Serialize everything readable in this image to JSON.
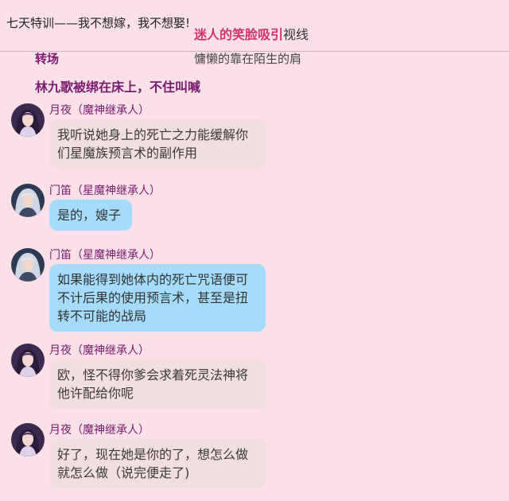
{
  "header": {
    "title": "七天特训——我不想嫁，我不想娶!",
    "overlay_highlight": "迷人的笑脸吸引",
    "overlay_rest": "视线"
  },
  "scene": {
    "label": "转场",
    "overlay": "慵懒的靠在陌生的肩"
  },
  "narration": "林九歌被绑在床上，不住叫喊",
  "messages": [
    {
      "speaker": "月夜（魔神继承人）",
      "text": "我听说她身上的死亡之力能缓解你们星魔族预言术的副作用",
      "avatar": "female-avatar-icon",
      "bubble": "pink"
    },
    {
      "speaker": "门笛（星魔神继承人）",
      "text": "是的，嫂子",
      "avatar": "male-avatar-icon",
      "bubble": "blue"
    },
    {
      "speaker": "门笛（星魔神继承人）",
      "text": "如果能得到她体内的死亡咒语便可不计后果的使用预言术，甚至是扭转不可能的战局",
      "avatar": "male-avatar-icon",
      "bubble": "blue"
    },
    {
      "speaker": "月夜（魔神继承人）",
      "text": "欧，怪不得你爹会求着死灵法神将他许配给你呢",
      "avatar": "female-avatar-icon",
      "bubble": "pink"
    },
    {
      "speaker": "月夜（魔神继承人）",
      "text": "好了，现在她是你的了，想怎么做就怎么做（说完便走了)",
      "avatar": "female-avatar-icon",
      "bubble": "pink"
    }
  ],
  "colors": {
    "background": "#fbe0ea",
    "speaker_text": "#7a1a6e",
    "highlight": "#d8316c",
    "bubble_pink": "#f2dede",
    "bubble_blue": "#a6dcfb"
  }
}
